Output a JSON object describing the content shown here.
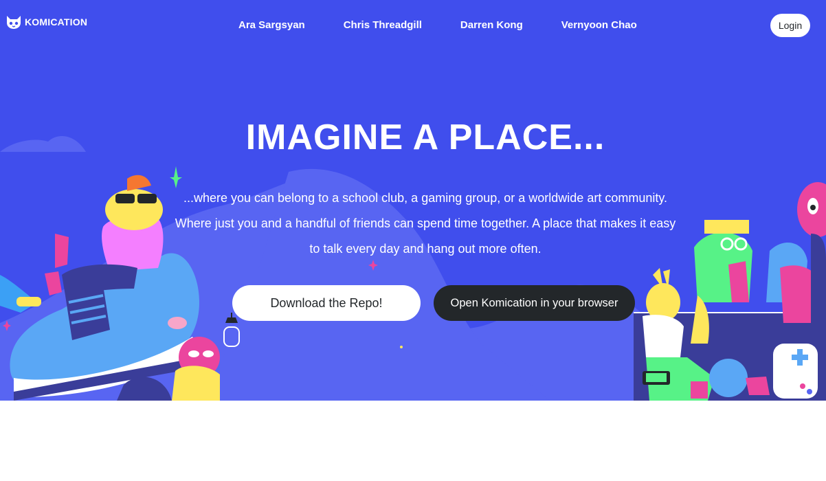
{
  "brand": {
    "name": "KOMICATION",
    "logo_icon": "cat-mascot-icon"
  },
  "nav": {
    "links": [
      {
        "label": "Ara Sargsyan"
      },
      {
        "label": "Chris Threadgill"
      },
      {
        "label": "Darren Kong"
      },
      {
        "label": "Vernyoon Chao"
      }
    ],
    "login_label": "Login"
  },
  "hero": {
    "title": "IMAGINE A PLACE...",
    "subtitle": "...where you can belong to a school club, a gaming group, or a worldwide art community. Where just you and a handful of friends can spend time together. A place that makes it easy to talk every day and hang out more often.",
    "download_label": "Download the Repo!",
    "open_label": "Open Komication in your browser"
  },
  "colors": {
    "hero_bg": "#404eed",
    "dark_button": "#23272a",
    "white": "#ffffff"
  }
}
